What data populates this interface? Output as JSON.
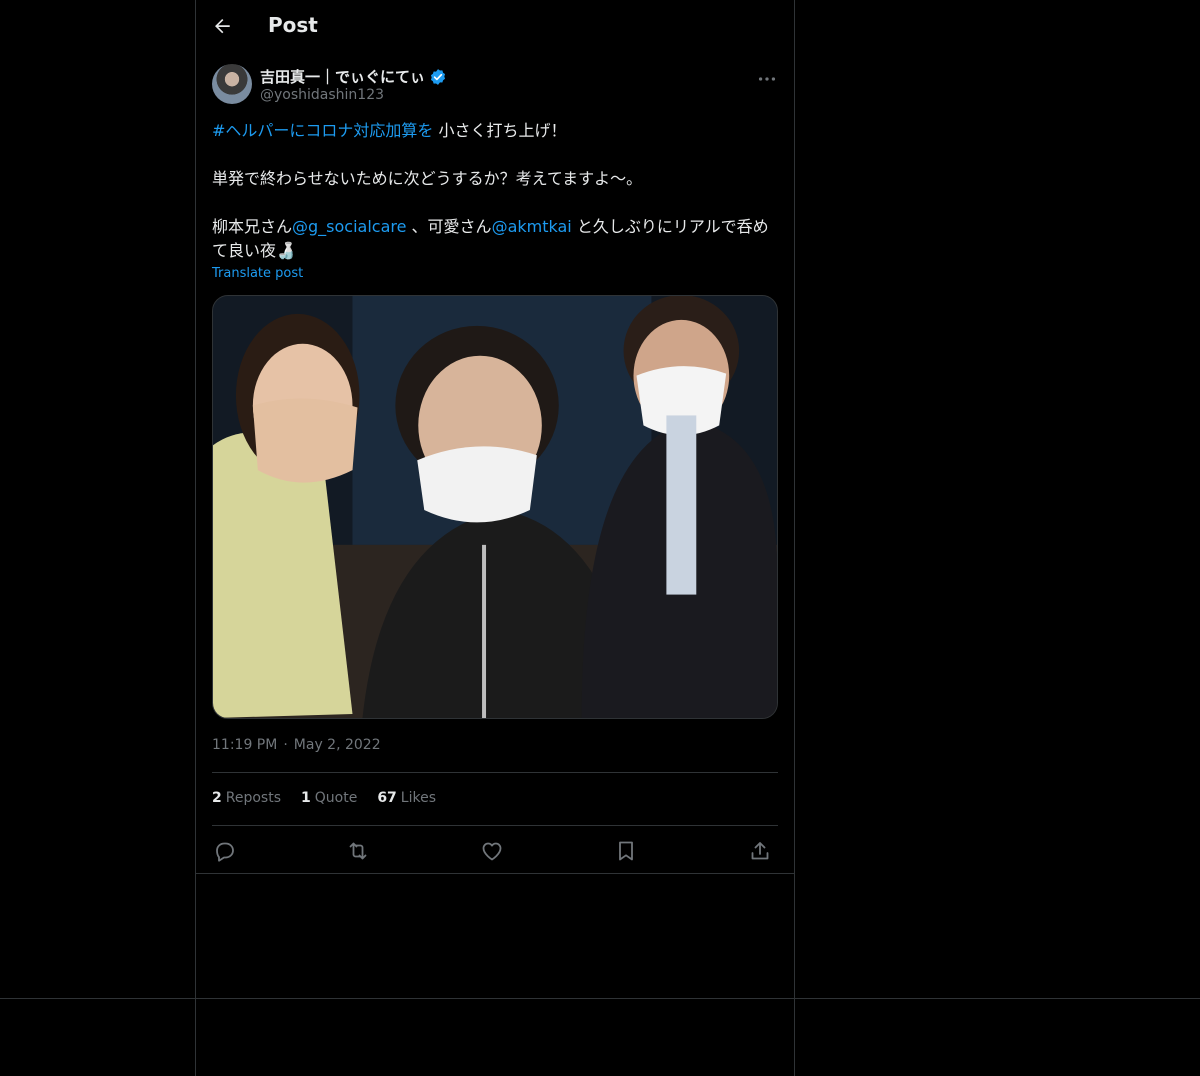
{
  "header": {
    "title": "Post",
    "back_icon": "arrow-left-icon"
  },
  "author": {
    "display_name": "吉田真一｜でぃぐにてぃ",
    "handle": "@yoshidashin123",
    "verified_icon": "verified-badge-icon",
    "verified_color": "#1d9bf0",
    "more_icon": "more-horizontal-icon"
  },
  "post": {
    "hashtag": "#ヘルパーにコロナ対応加算を",
    "line1_rest": " 小さく打ち上げ！",
    "line2": "単発で終わらせないために次どうするか？考えてますよ〜。",
    "line3_a": "柳本兄さん",
    "mention1": "@g_socialcare",
    "line3_b": " 、可愛さん",
    "mention2": "@akmtkai",
    "line3_c": " と久しぶりにリアルで呑めて良い夜🍶",
    "translate": "Translate post",
    "image_alt": "photo"
  },
  "meta": {
    "time": "11:19 PM",
    "dot": "·",
    "date": "May 2, 2022"
  },
  "stats": {
    "reposts_count": "2",
    "reposts_label": "Reposts",
    "quotes_count": "1",
    "quotes_label": "Quote",
    "likes_count": "67",
    "likes_label": "Likes"
  },
  "actions": [
    "reply-icon",
    "repost-icon",
    "like-icon",
    "bookmark-icon",
    "share-icon"
  ],
  "colors": {
    "background": "#000000",
    "text": "#e7e9ea",
    "secondary": "#71767b",
    "accent": "#1d9bf0",
    "border": "#2f3336"
  }
}
